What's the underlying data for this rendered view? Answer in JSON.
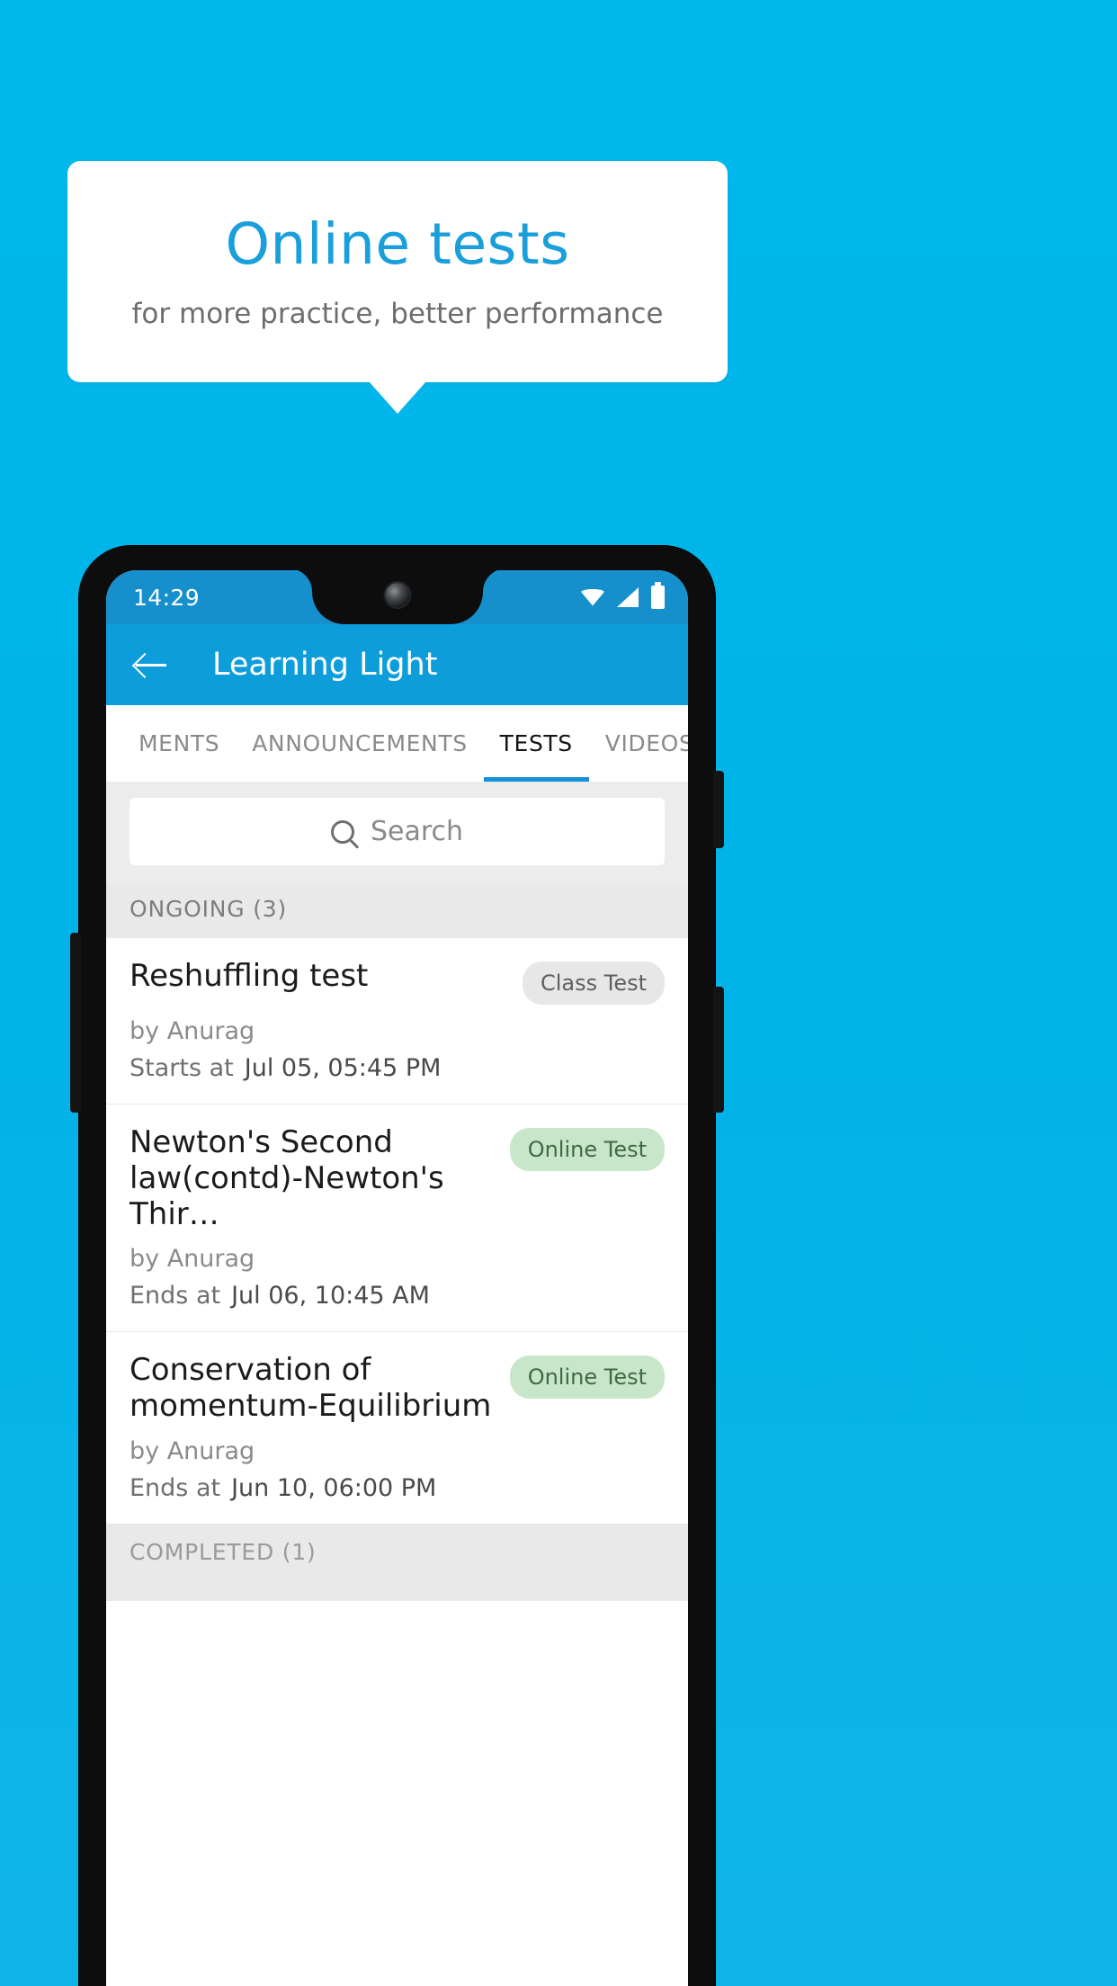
{
  "promo": {
    "title": "Online tests",
    "subtitle": "for more practice, better performance"
  },
  "colors": {
    "background": "#00b8ea",
    "accent": "#1a9fdb",
    "appbar": "#0d9ddb",
    "statusbar": "#1590cd",
    "badge_online_bg": "#c8e6c9",
    "badge_class_bg": "#e7e7e7"
  },
  "phone": {
    "statusbar": {
      "time": "14:29",
      "icons": [
        "wifi-icon",
        "signal-icon",
        "battery-icon"
      ]
    },
    "appbar": {
      "back_icon": "back-arrow-icon",
      "title": "Learning Light"
    },
    "tabs": [
      {
        "label": "MENTS",
        "active": false
      },
      {
        "label": "ANNOUNCEMENTS",
        "active": false
      },
      {
        "label": "TESTS",
        "active": true
      },
      {
        "label": "VIDEOS",
        "active": false
      }
    ],
    "search": {
      "icon": "search-icon",
      "placeholder": "Search",
      "value": ""
    },
    "sections": [
      {
        "header": "ONGOING (3)",
        "items": [
          {
            "title": "Reshuffling test",
            "badge": "Class Test",
            "badge_type": "class",
            "author": "by Anurag",
            "time_label": "Starts at",
            "time_value": "Jul 05, 05:45 PM"
          },
          {
            "title": "Newton's Second law(contd)-Newton's Thir…",
            "badge": "Online Test",
            "badge_type": "online",
            "author": "by Anurag",
            "time_label": "Ends at",
            "time_value": "Jul 06, 10:45 AM"
          },
          {
            "title": "Conservation of momentum-Equilibrium",
            "badge": "Online Test",
            "badge_type": "online",
            "author": "by Anurag",
            "time_label": "Ends at",
            "time_value": "Jun 10, 06:00 PM"
          }
        ]
      },
      {
        "header": "COMPLETED (1)",
        "items": []
      }
    ]
  }
}
